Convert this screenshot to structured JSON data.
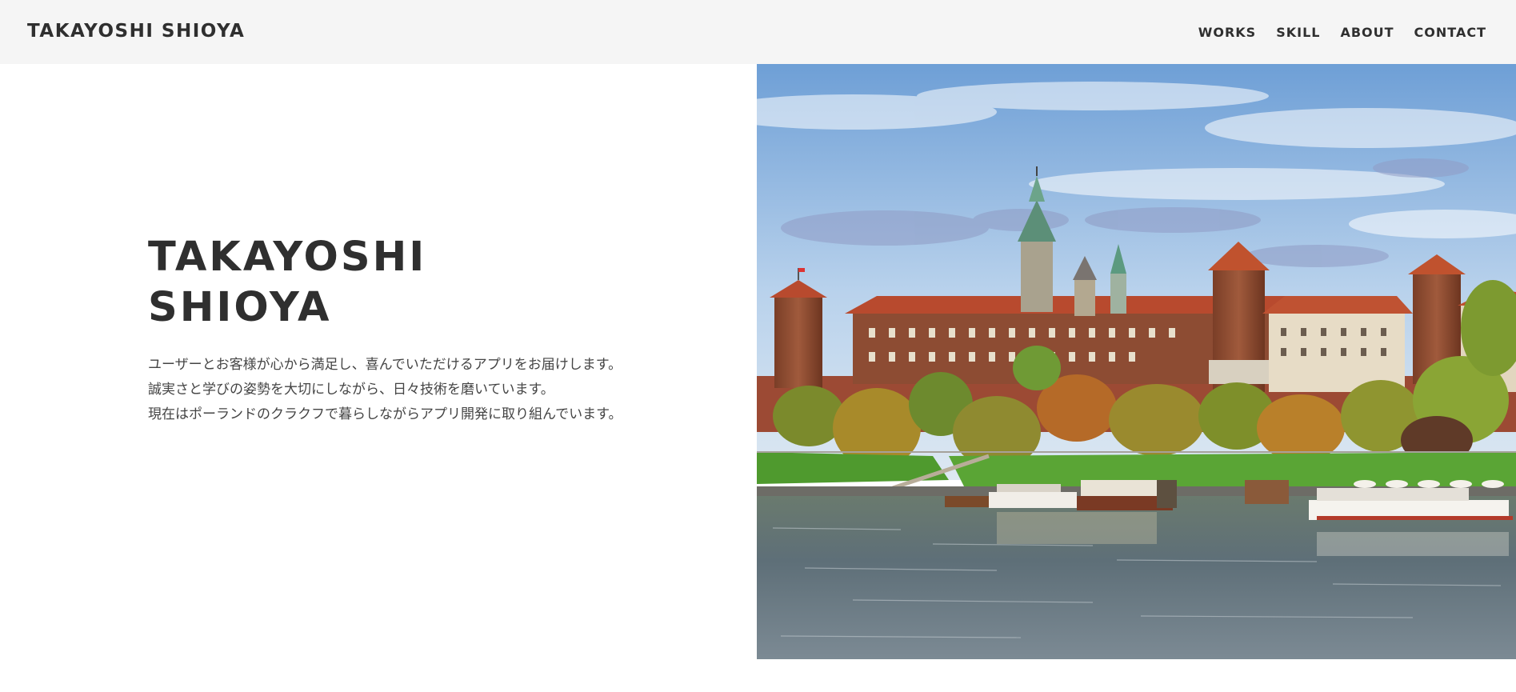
{
  "header": {
    "brand": "TAKAYOSHI SHIOYA",
    "nav": [
      "WORKS",
      "SKILL",
      "ABOUT",
      "CONTACT"
    ]
  },
  "hero": {
    "title_line1": "TAKAYOSHI",
    "title_line2": "SHIOYA",
    "lines": [
      "ユーザーとお客様が心から満足し、喜んでいただけるアプリをお届けします。",
      "誠実さと学びの姿勢を大切にしながら、日々技術を磨いています。",
      "現在はポーランドのクラクフで暮らしながらアプリ開発に取り組んでいます。"
    ]
  },
  "colors": {
    "header_bg": "#f5f5f5",
    "text": "#2f2f2f",
    "roof": "#b84a2e",
    "brick": "#8a4a30",
    "grass": "#4f9a2e",
    "river": "#5b6b74",
    "sky": "#9ebfe0"
  },
  "image": {
    "subject": "castle-on-river-photo"
  }
}
